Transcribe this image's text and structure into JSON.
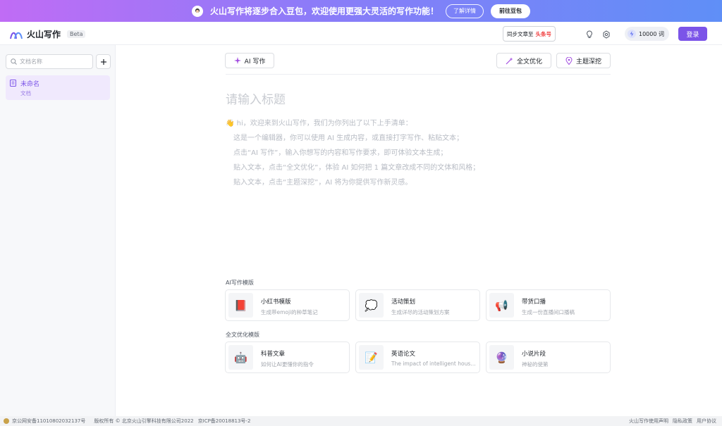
{
  "banner": {
    "text": "火山写作将逐步合入豆包，欢迎使用更强大灵活的写作功能！",
    "learn_more": "了解详情",
    "go_doubao": "前往豆包"
  },
  "header": {
    "logo_text": "火山写作",
    "beta": "Beta",
    "sync_prefix": "同步文章至",
    "sync_target": "头条号",
    "word_count": "10000 词",
    "login": "登录"
  },
  "sidebar": {
    "search_placeholder": "文档名称",
    "doc": {
      "title": "未命名",
      "subtitle": "文档"
    }
  },
  "toolbar": {
    "ai_write": "AI 写作",
    "full_optimize": "全文优化",
    "topic_dig": "主题深挖"
  },
  "editor": {
    "title_placeholder": "请输入标题",
    "intro": "👋 hi，欢迎来到火山写作，我们为你列出了以下上手清单：",
    "lines": [
      "这是一个编辑器，你可以使用 AI 生成内容，或直接打字写作、粘贴文本；",
      "点击“AI 写作”，输入你想写的内容和写作要求，即可体验文本生成；",
      "贴入文本，点击“全文优化”，体验 AI 如何把 1 篇文章改成不同的文体和风格；",
      "贴入文本，点击“主题深挖”，AI 将为你提供写作新灵感。"
    ]
  },
  "templates": {
    "ai_label": "AI写作模版",
    "ai": [
      {
        "icon": "📕",
        "title": "小红书模版",
        "desc": "生成带emoji的种草笔记"
      },
      {
        "icon": "💭",
        "title": "活动策划",
        "desc": "生成详尽的活动策划方案"
      },
      {
        "icon": "📢",
        "title": "带货口播",
        "desc": "生成一份直播间口播稿"
      }
    ],
    "opt_label": "全文优化模版",
    "opt": [
      {
        "icon": "🤖",
        "title": "科普文章",
        "desc": "如何让AI更懂你的指令"
      },
      {
        "icon": "📝",
        "title": "英语论文",
        "desc": "The impact of intelligent household appliances"
      },
      {
        "icon": "🔮",
        "title": "小说片段",
        "desc": "神秘的使第"
      }
    ]
  },
  "footer": {
    "beian": "京公网安备11010802032137号",
    "copyright": "版权所有 © 北京火山引擎科技有限公司2022",
    "icp": "京ICP备20018813号-2",
    "statement": "火山写作使用声明",
    "privacy": "隐私政策",
    "agreement": "用户协议"
  },
  "colors": {
    "accent": "#7b54e8",
    "toutiao": "#f04142"
  }
}
